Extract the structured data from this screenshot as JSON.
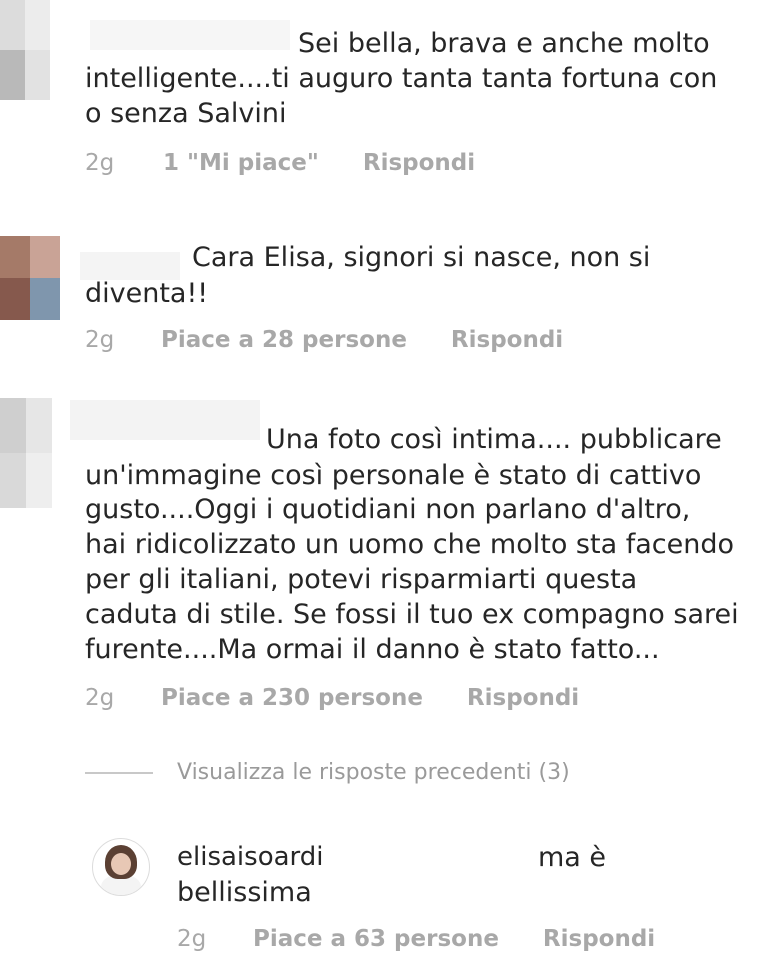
{
  "comments": [
    {
      "lines": [
        "Sei bella, brava e anche molto",
        "intelligente....ti auguro tanta tanta fortuna con",
        "o senza Salvini"
      ],
      "time": "2g",
      "likes": "1 \"Mi piace\"",
      "reply": "Rispondi"
    },
    {
      "lines": [
        "Cara Elisa, signori si nasce, non si",
        "diventa!!"
      ],
      "time": "2g",
      "likes": "Piace a 28 persone",
      "reply": "Rispondi"
    },
    {
      "lines": [
        "Una foto così intima.... pubblicare",
        "un'immagine così personale è  stato di cattivo",
        "gusto....Oggi i quotidiani non parlano d'altro,",
        "hai ridicolizzato un uomo che molto sta facendo",
        "per gli italiani, potevi risparmiarti  questa",
        "caduta di stile. Se fossi il tuo ex compagno sarei",
        "furente....Ma ormai il danno è  stato fatto..."
      ],
      "time": "2g",
      "likes": "Piace a 230 persone",
      "reply": "Rispondi"
    }
  ],
  "view_replies": "Visualizza le risposte precedenti (3)",
  "reply_comment": {
    "username": "elisaisoardi",
    "text_first": "ma è",
    "text_second": "bellissima",
    "time": "2g",
    "likes": "Piace a 63 persone",
    "reply": "Rispondi"
  },
  "colors": {
    "text": "#262626",
    "meta": "#a8a8a8",
    "divider": "#c8c8c8"
  }
}
